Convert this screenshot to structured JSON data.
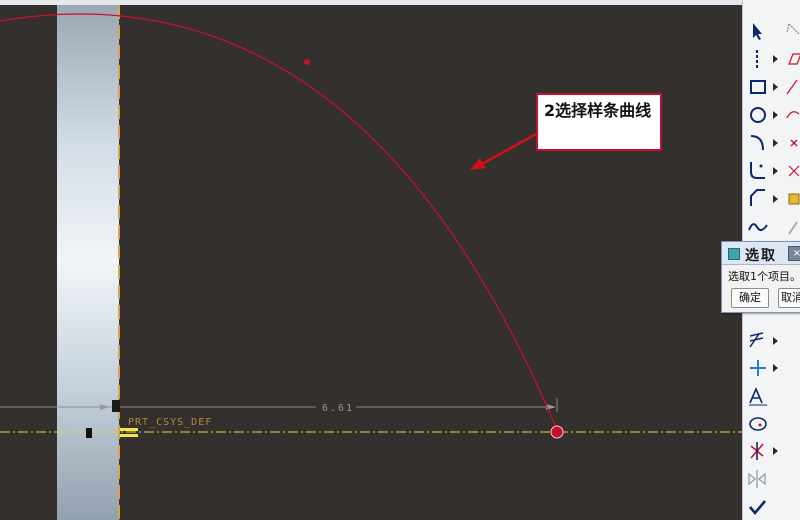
{
  "canvas": {
    "csys_label": "PRT_CSYS_DEF",
    "dimension_value": "6.61"
  },
  "annotation": {
    "callout_text": "2选择样条曲线"
  },
  "select_dialog": {
    "title": "选取",
    "close_glyph": "×",
    "message": "选取1个项目。",
    "ok_label": "确定",
    "cancel_label": "取消"
  },
  "toolbar": {
    "tools": [
      {
        "icon": "select-arrow-icon",
        "has_menu": false,
        "secondary": "dimension-icon"
      },
      {
        "icon": "centerline-icon",
        "has_menu": true,
        "secondary": "parallelogram-icon"
      },
      {
        "icon": "rectangle-icon",
        "has_menu": true,
        "secondary": "line-icon"
      },
      {
        "icon": "circle-icon",
        "has_menu": true,
        "secondary": "arc-icon"
      },
      {
        "icon": "arc-icon",
        "has_menu": true,
        "secondary": "x-mark-icon"
      },
      {
        "icon": "fillet-icon",
        "has_menu": true,
        "secondary": "trim-icon"
      },
      {
        "icon": "chamfer-icon",
        "has_menu": true,
        "secondary": "palette-icon"
      },
      {
        "icon": "spline-icon",
        "has_menu": false,
        "secondary": "pen-icon"
      },
      {
        "icon": "offset-icon",
        "has_menu": true,
        "secondary": ""
      },
      {
        "icon": "point-icon",
        "has_menu": true,
        "secondary": ""
      },
      {
        "icon": "text-icon",
        "has_menu": false,
        "secondary": ""
      },
      {
        "icon": "palette-icon",
        "has_menu": false,
        "secondary": ""
      },
      {
        "icon": "trim-icon",
        "has_menu": true,
        "secondary": ""
      },
      {
        "icon": "mirror-icon",
        "has_menu": false,
        "secondary": ""
      },
      {
        "icon": "check-icon",
        "has_menu": false,
        "secondary": ""
      }
    ]
  },
  "colors": {
    "background": "#34302d",
    "sketch_red": "#c8102e",
    "csys_yellow": "#e8d23a",
    "toolbar_bg": "#f3f4f6"
  }
}
